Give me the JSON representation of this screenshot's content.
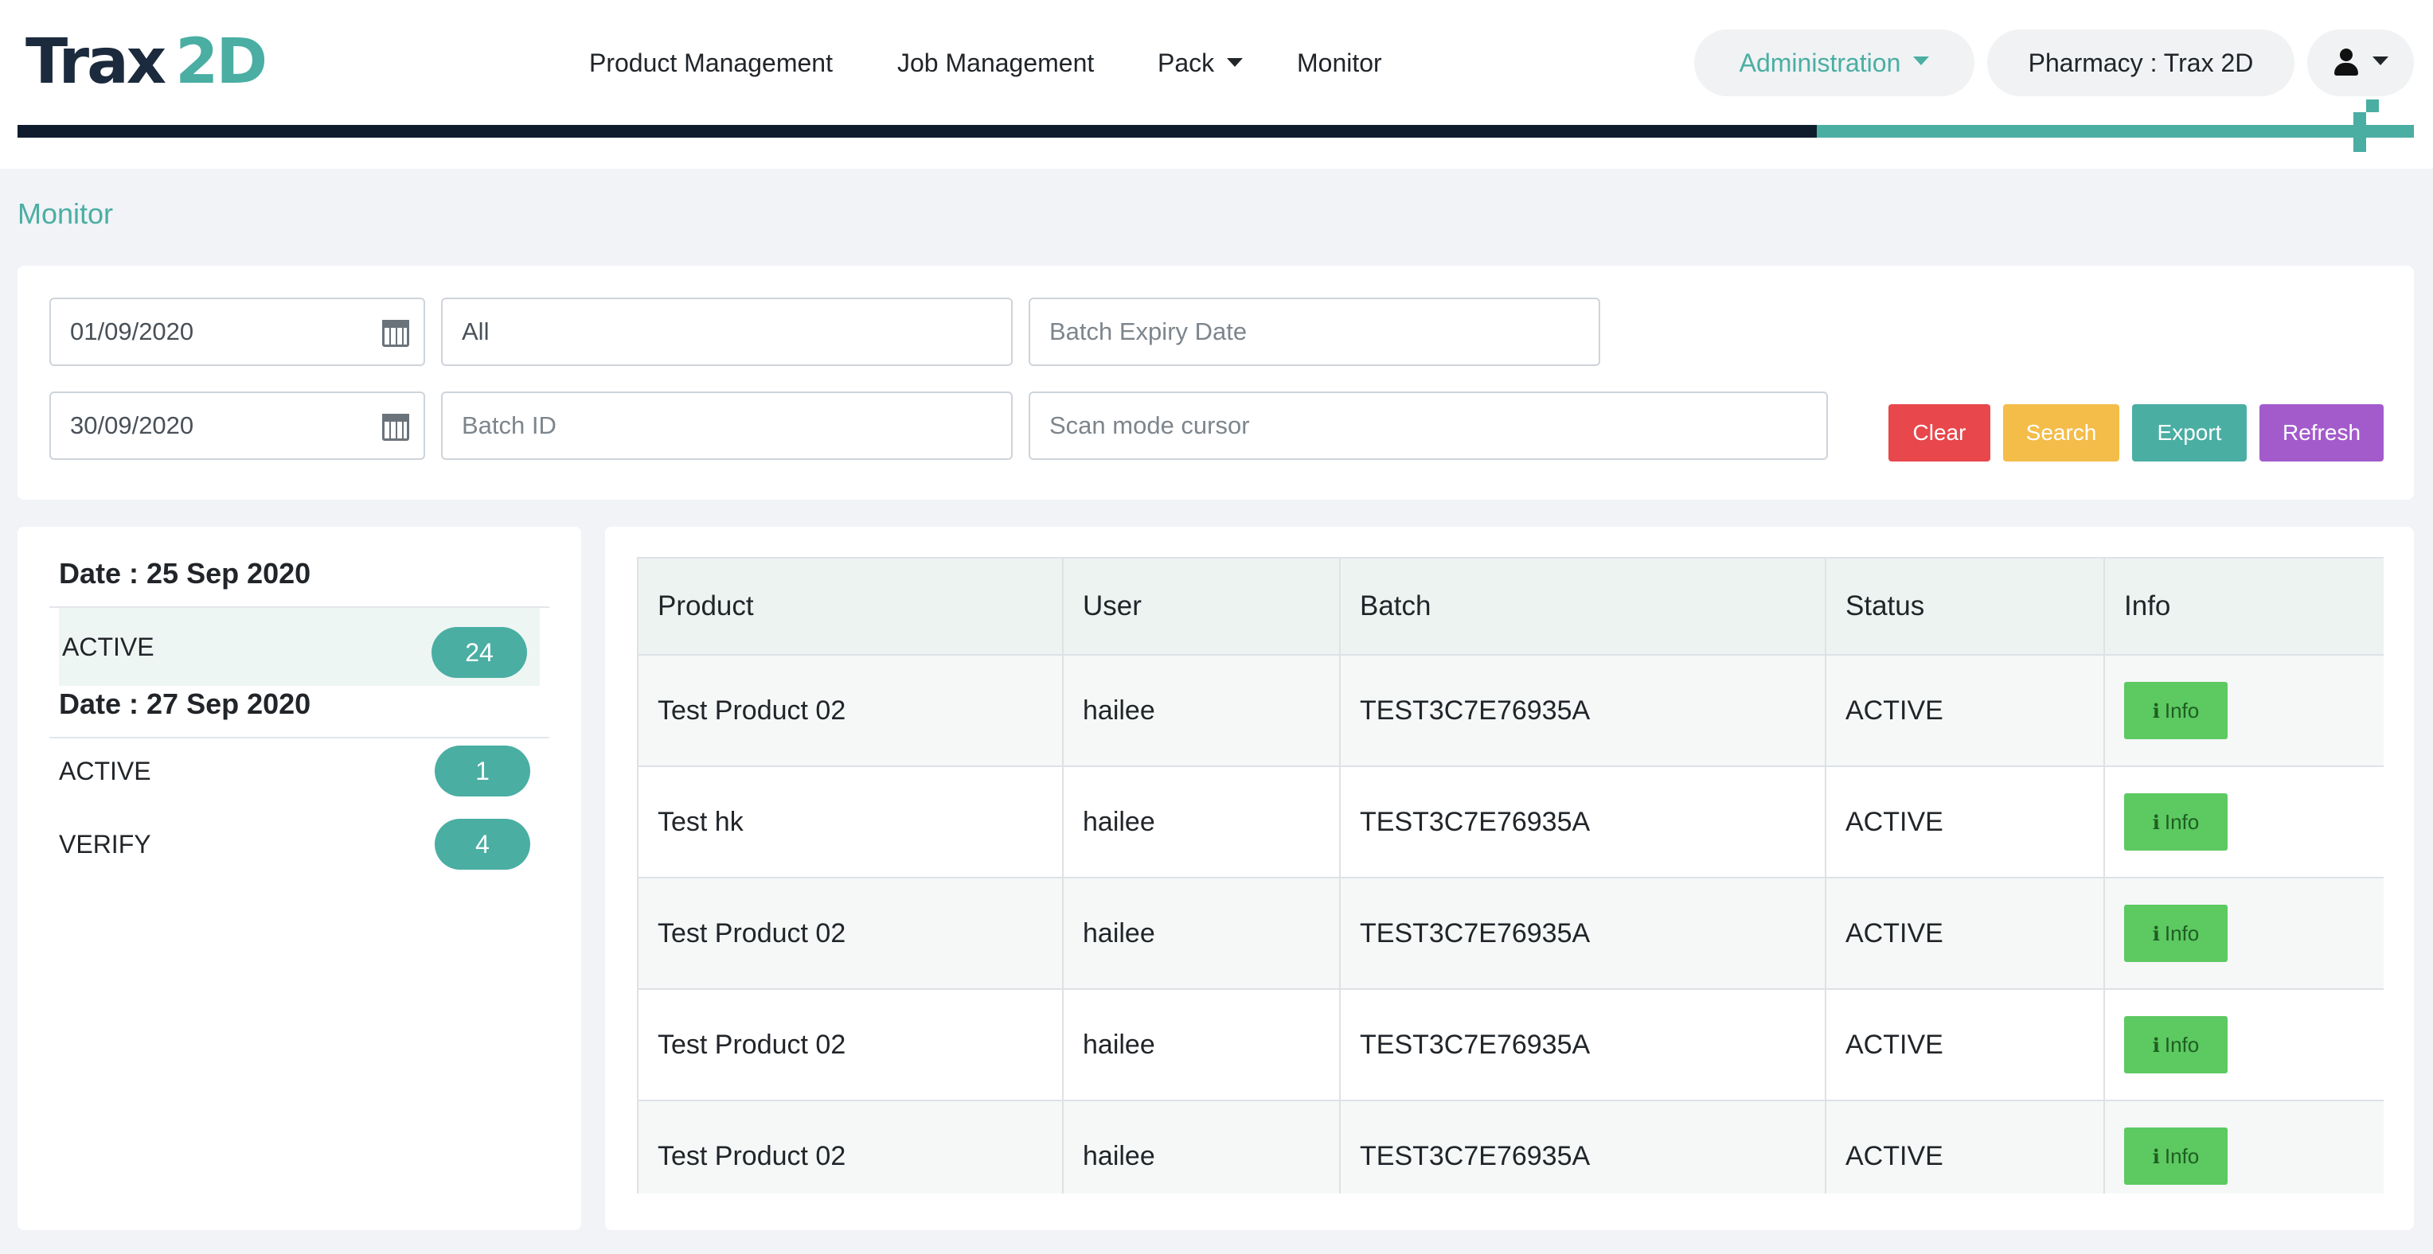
{
  "brand": {
    "logo_main": "Trax",
    "logo_accent": "2D"
  },
  "nav": {
    "items": [
      {
        "label": "Product Management"
      },
      {
        "label": "Job Management"
      },
      {
        "label": "Pack"
      },
      {
        "label": "Monitor"
      }
    ],
    "admin_label": "Administration",
    "pharmacy_label": "Pharmacy : Trax 2D"
  },
  "colors": {
    "accent": "#4aaea3",
    "dark": "#0e1c2e",
    "clear": "#e8474b",
    "search": "#f4bd49",
    "export": "#4aaea3",
    "refresh": "#a35bcc",
    "info": "#5cc961"
  },
  "page": {
    "title": "Monitor"
  },
  "filters": {
    "date_from": "01/09/2020",
    "date_to": "30/09/2020",
    "status_value": "All",
    "batch_expiry_placeholder": "Batch Expiry Date",
    "batch_id_placeholder": "Batch ID",
    "scan_placeholder": "Scan mode cursor",
    "icons": [
      "calendar-icon",
      "calendar-icon"
    ]
  },
  "buttons": {
    "clear": "Clear",
    "search": "Search",
    "export": "Export",
    "refresh": "Refresh"
  },
  "summary": [
    {
      "date": "Date : 25 Sep 2020",
      "rows": [
        {
          "status": "ACTIVE",
          "count": "24"
        }
      ]
    },
    {
      "date": "Date : 27 Sep 2020",
      "rows": [
        {
          "status": "ACTIVE",
          "count": "1"
        },
        {
          "status": "VERIFY",
          "count": "4"
        }
      ]
    }
  ],
  "table": {
    "headers": [
      "Product",
      "User",
      "Batch",
      "Status",
      "Info"
    ],
    "info_label": "Info",
    "rows": [
      {
        "product": "Test Product 02",
        "user": "hailee",
        "batch": "TEST3C7E76935A",
        "status": "ACTIVE"
      },
      {
        "product": "Test hk",
        "user": "hailee",
        "batch": "TEST3C7E76935A",
        "status": "ACTIVE"
      },
      {
        "product": "Test Product 02",
        "user": "hailee",
        "batch": "TEST3C7E76935A",
        "status": "ACTIVE"
      },
      {
        "product": "Test Product 02",
        "user": "hailee",
        "batch": "TEST3C7E76935A",
        "status": "ACTIVE"
      },
      {
        "product": "Test Product 02",
        "user": "hailee",
        "batch": "TEST3C7E76935A",
        "status": "ACTIVE"
      }
    ]
  }
}
